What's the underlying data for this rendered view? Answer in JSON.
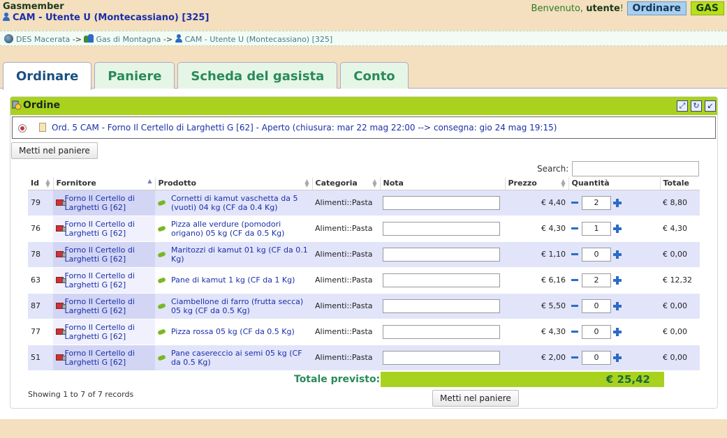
{
  "header": {
    "app_name": "Gasmember",
    "user_label": "CAM - Utente U (Montecassiano) [325]",
    "welcome_prefix": "Benvenuto,",
    "welcome_user": "utente",
    "welcome_suffix": "!",
    "role_ordinare": "Ordinare",
    "role_gas": "GAS"
  },
  "breadcrumb": {
    "des": "DES Macerata",
    "sep1": "->",
    "gas": "Gas di Montagna",
    "sep2": "->",
    "user": "CAM - Utente U (Montecassiano) [325]"
  },
  "tabs": [
    {
      "label": "Ordinare",
      "active": true
    },
    {
      "label": "Paniere"
    },
    {
      "label": "Scheda del gasista"
    },
    {
      "label": "Conto"
    }
  ],
  "panel": {
    "title": "Ordine",
    "order_text": "Ord. 5 CAM - Forno Il Certello di Larghetti G [62] - Aperto (chiusura: mar 22 mag 22:00 --> consegna: gio 24 mag 19:15)",
    "put_in_basket": "Metti nel paniere",
    "search_label": "Search:",
    "search_value": "",
    "columns": [
      "Id",
      "Fornitore",
      "Prodotto",
      "Categoria",
      "Nota",
      "Prezzo",
      "Quantità",
      "Totale"
    ],
    "rows": [
      {
        "id": "79",
        "supplier": "Forno Il Certello di Larghetti G [62]",
        "product": "Cornetti di kamut vaschetta da 5 (vuoti) 04 kg (CF da 0.4 Kg)",
        "category": "Alimenti::Pasta",
        "price": "€ 4,40",
        "qty": "2",
        "total": "€ 8,80"
      },
      {
        "id": "76",
        "supplier": "Forno Il Certello di Larghetti G [62]",
        "product": "Pizza alle verdure (pomodori origano) 05 kg (CF da 0.5 Kg)",
        "category": "Alimenti::Pasta",
        "price": "€ 4,30",
        "qty": "1",
        "total": "€ 4,30"
      },
      {
        "id": "78",
        "supplier": "Forno Il Certello di Larghetti G [62]",
        "product": "Maritozzi di kamut 01 kg (CF da 0.1 Kg)",
        "category": "Alimenti::Pasta",
        "price": "€ 1,10",
        "qty": "0",
        "total": "€ 0,00"
      },
      {
        "id": "63",
        "supplier": "Forno Il Certello di Larghetti G [62]",
        "product": "Pane di kamut 1 kg (CF da 1 Kg)",
        "category": "Alimenti::Pasta",
        "price": "€ 6,16",
        "qty": "2",
        "total": "€ 12,32"
      },
      {
        "id": "87",
        "supplier": "Forno Il Certello di Larghetti G [62]",
        "product": "Ciambellone di farro (frutta secca) 05 kg (CF da 0.5 Kg)",
        "category": "Alimenti::Pasta",
        "price": "€ 5,50",
        "qty": "0",
        "total": "€ 0,00"
      },
      {
        "id": "77",
        "supplier": "Forno Il Certello di Larghetti G [62]",
        "product": "Pizza rossa 05 kg (CF da 0.5 Kg)",
        "category": "Alimenti::Pasta",
        "price": "€ 4,30",
        "qty": "0",
        "total": "€ 0,00"
      },
      {
        "id": "51",
        "supplier": "Forno Il Certello di Larghetti G [62]",
        "product": "Pane casereccio ai semi 05 kg (CF da 0.5 Kg)",
        "category": "Alimenti::Pasta",
        "price": "€ 2,00",
        "qty": "0",
        "total": "€ 0,00"
      }
    ],
    "total_label": "Totale previsto:",
    "total_value": "€  25,42",
    "records_info": "Showing 1 to 7 of 7 records"
  }
}
